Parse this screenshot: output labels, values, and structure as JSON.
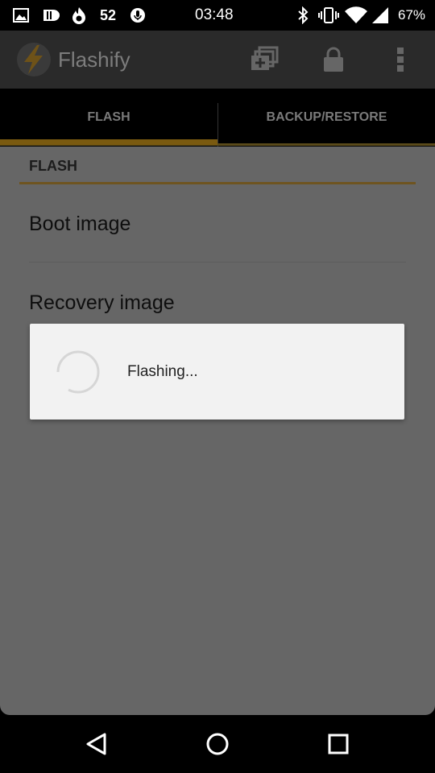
{
  "status_bar": {
    "temperature": "52",
    "time": "03:48",
    "battery": "67%",
    "icons": [
      "image-notification-icon",
      "storage-notification-icon",
      "flame-icon",
      "mic-notification-icon",
      "bluetooth-icon",
      "vibrate-icon",
      "wifi-icon",
      "signal-icon",
      "battery-icon"
    ]
  },
  "action_bar": {
    "title": "Flashify",
    "icons": [
      "flashify-logo-icon",
      "add-queue-icon",
      "lock-icon",
      "overflow-menu-icon"
    ]
  },
  "tabs": [
    {
      "label": "FLASH",
      "selected": true
    },
    {
      "label": "BACKUP/RESTORE",
      "selected": false
    }
  ],
  "section": {
    "header": "FLASH",
    "items": [
      {
        "label": "Boot image"
      },
      {
        "label": "Recovery image"
      }
    ]
  },
  "dialog": {
    "message": "Flashing..."
  },
  "nav_bar": {
    "icons": [
      "back-icon",
      "home-icon",
      "recents-icon"
    ]
  },
  "colors": {
    "accent": "#7a5a10",
    "dim_background": "#666666",
    "dialog_background": "#f2f2f2"
  }
}
